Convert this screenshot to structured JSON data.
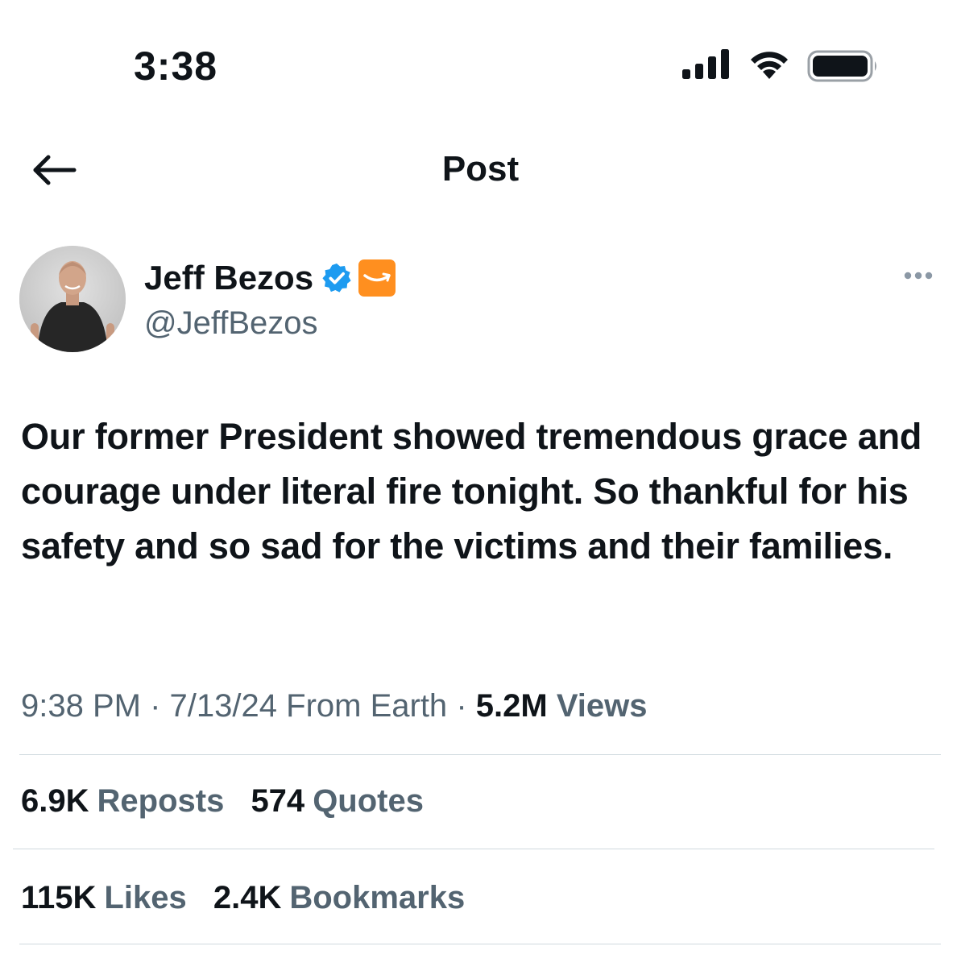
{
  "status_bar": {
    "time": "3:38",
    "icons": [
      "cellular-signal-icon",
      "wifi-icon",
      "battery-icon"
    ]
  },
  "nav": {
    "back_icon": "arrow-left-icon",
    "title": "Post"
  },
  "author": {
    "display_name": "Jeff Bezos",
    "handle": "@JeffBezos",
    "verified_color": "#1d9bf0",
    "affiliate_badge_color": "#ff8f1f"
  },
  "post": {
    "text": "Our former President showed tremendous grace and courage under literal fire tonight. So thankful for his safety and so sad for the victims and their families."
  },
  "meta": {
    "time": "9:38 PM",
    "separator": "·",
    "date": "7/13/24",
    "source": "From Earth",
    "views_count": "5.2M",
    "views_label": "Views"
  },
  "stats": {
    "reposts": {
      "count": "6.9K",
      "label": "Reposts"
    },
    "quotes": {
      "count": "574",
      "label": "Quotes"
    },
    "likes": {
      "count": "115K",
      "label": "Likes"
    },
    "bookmarks": {
      "count": "2.4K",
      "label": "Bookmarks"
    }
  },
  "colors": {
    "text_primary": "#0f1419",
    "text_secondary": "#536471",
    "divider": "#cfd9de"
  }
}
